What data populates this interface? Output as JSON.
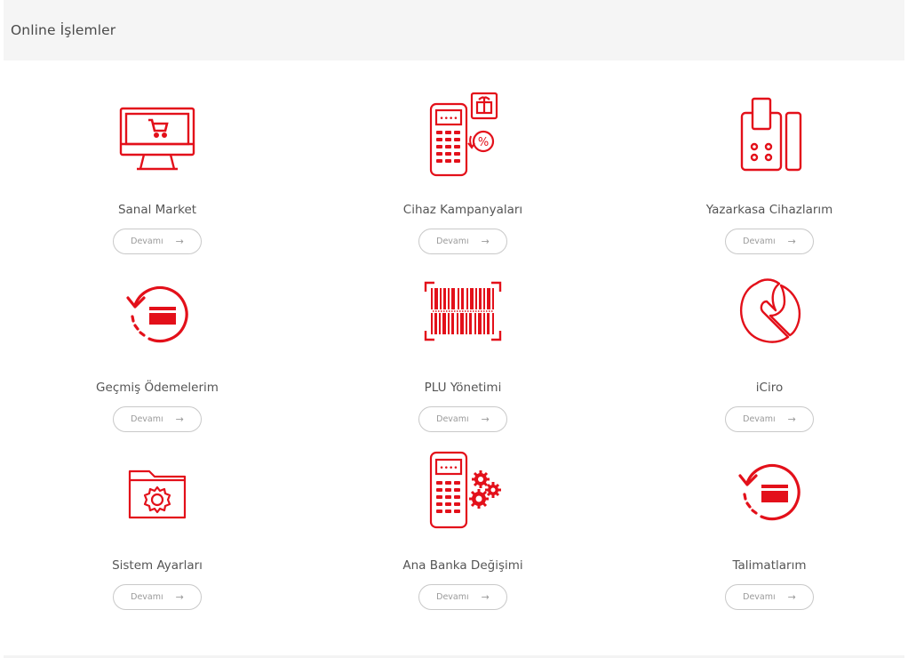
{
  "header": {
    "title": "Online İşlemler"
  },
  "button_label": "Devamı",
  "accent_color": "#e3101a",
  "cards": [
    {
      "label": "Sanal Market",
      "icon": "monitor-cart-icon"
    },
    {
      "label": "Cihaz Kampanyaları",
      "icon": "pos-gift-percent-icon"
    },
    {
      "label": "Yazarkasa Cihazlarım",
      "icon": "cash-register-device-icon"
    },
    {
      "label": "Geçmiş Ödemelerim",
      "icon": "payment-history-icon"
    },
    {
      "label": "PLU Yönetimi",
      "icon": "barcode-icon"
    },
    {
      "label": "iCiro",
      "icon": "iciro-icon"
    },
    {
      "label": "Sistem Ayarları",
      "icon": "folder-gear-icon"
    },
    {
      "label": "Ana Banka Değişimi",
      "icon": "pos-gears-icon"
    },
    {
      "label": "Talimatlarım",
      "icon": "instructions-icon"
    }
  ]
}
